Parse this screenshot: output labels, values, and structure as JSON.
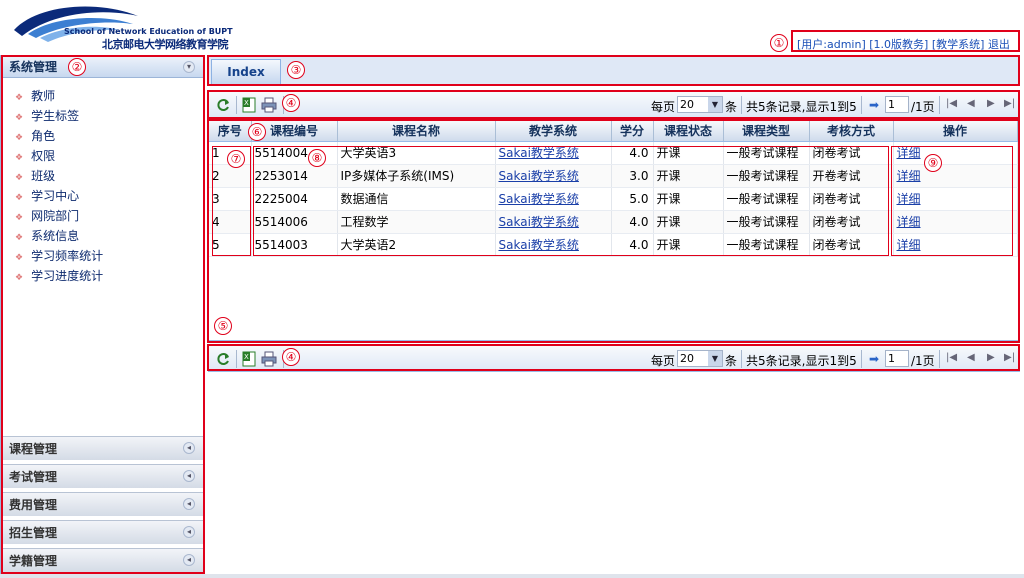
{
  "header": {
    "logo_en": "School of Network Education of BUPT",
    "logo_zh": "北京邮电大学网络教育学院",
    "user_links": [
      "[用户:admin]",
      "[1.0版教务]",
      "[教学系统]",
      "退出"
    ]
  },
  "sidebar": {
    "title": "系统管理",
    "items": [
      "教师",
      "学生标签",
      "角色",
      "权限",
      "班级",
      "学习中心",
      "网院部门",
      "系统信息",
      "学习频率统计",
      "学习进度统计"
    ],
    "sections": [
      "课程管理",
      "考试管理",
      "费用管理",
      "招生管理",
      "学籍管理"
    ]
  },
  "tabs": [
    {
      "label": "Index"
    }
  ],
  "toolbar": {
    "per_page_label": "每页",
    "per_page_value": "20",
    "per_page_unit": "条",
    "record_info": "共5条记录,显示1到5",
    "page_value": "1",
    "page_total": "/1页"
  },
  "grid": {
    "columns": [
      "序号",
      "课程编号",
      "课程名称",
      "教学系统",
      "学分",
      "课程状态",
      "课程类型",
      "考核方式",
      "操作"
    ],
    "rows": [
      {
        "no": "1",
        "code": "5514004",
        "name": "大学英语3",
        "system": "Sakai教学系统",
        "credit": "4.0",
        "status": "开课",
        "type": "一般考试课程",
        "exam": "闭卷考试",
        "action": "详细"
      },
      {
        "no": "2",
        "code": "2253014",
        "name": "IP多媒体子系统(IMS)",
        "system": "Sakai教学系统",
        "credit": "3.0",
        "status": "开课",
        "type": "一般考试课程",
        "exam": "开卷考试",
        "action": "详细"
      },
      {
        "no": "3",
        "code": "2225004",
        "name": "数据通信",
        "system": "Sakai教学系统",
        "credit": "5.0",
        "status": "开课",
        "type": "一般考试课程",
        "exam": "闭卷考试",
        "action": "详细"
      },
      {
        "no": "4",
        "code": "5514006",
        "name": "工程数学",
        "system": "Sakai教学系统",
        "credit": "4.0",
        "status": "开课",
        "type": "一般考试课程",
        "exam": "闭卷考试",
        "action": "详细"
      },
      {
        "no": "5",
        "code": "5514003",
        "name": "大学英语2",
        "system": "Sakai教学系统",
        "credit": "4.0",
        "status": "开课",
        "type": "一般考试课程",
        "exam": "闭卷考试",
        "action": "详细"
      }
    ]
  },
  "annotations": [
    "①",
    "②",
    "③",
    "④",
    "⑤",
    "⑥",
    "⑦",
    "⑧",
    "⑨"
  ],
  "colors": {
    "annotation_red": "#e0001a",
    "link_blue": "#1a3fa8",
    "header_blue": "#dfe8f6"
  }
}
